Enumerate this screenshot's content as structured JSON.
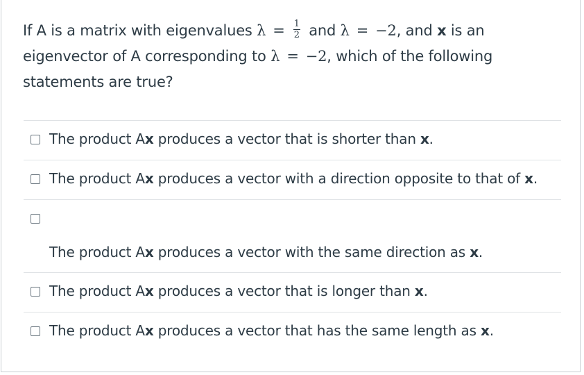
{
  "question": {
    "part1": "If A is a matrix with eigenvalues ",
    "lambda": "λ",
    "equals": "=",
    "frac_num": "1",
    "frac_den": "2",
    "and_text": " and ",
    "minus_two": "−2",
    "part2": ", and ",
    "x_bold": "x",
    "part3": " is an eigenvector of A corresponding to ",
    "part4": ", which of the following statements are true?"
  },
  "answers": [
    {
      "prefix": "The product A",
      "x": "x",
      "suffix": " produces a vector that is shorter than ",
      "end_x": "x",
      "end": "."
    },
    {
      "prefix": "The product A",
      "x": "x",
      "suffix": " produces a vector with a direction opposite to that of ",
      "end_x": "x",
      "end": "."
    },
    {
      "prefix": "The product A",
      "x": "x",
      "suffix": " produces a vector with the same direction as ",
      "end_x": "x",
      "end": "."
    },
    {
      "prefix": "The product A",
      "x": "x",
      "suffix": " produces a vector that is longer than ",
      "end_x": "x",
      "end": "."
    },
    {
      "prefix": "The product A",
      "x": "x",
      "suffix": " produces a vector that has the same length as ",
      "end_x": "x",
      "end": "."
    }
  ]
}
